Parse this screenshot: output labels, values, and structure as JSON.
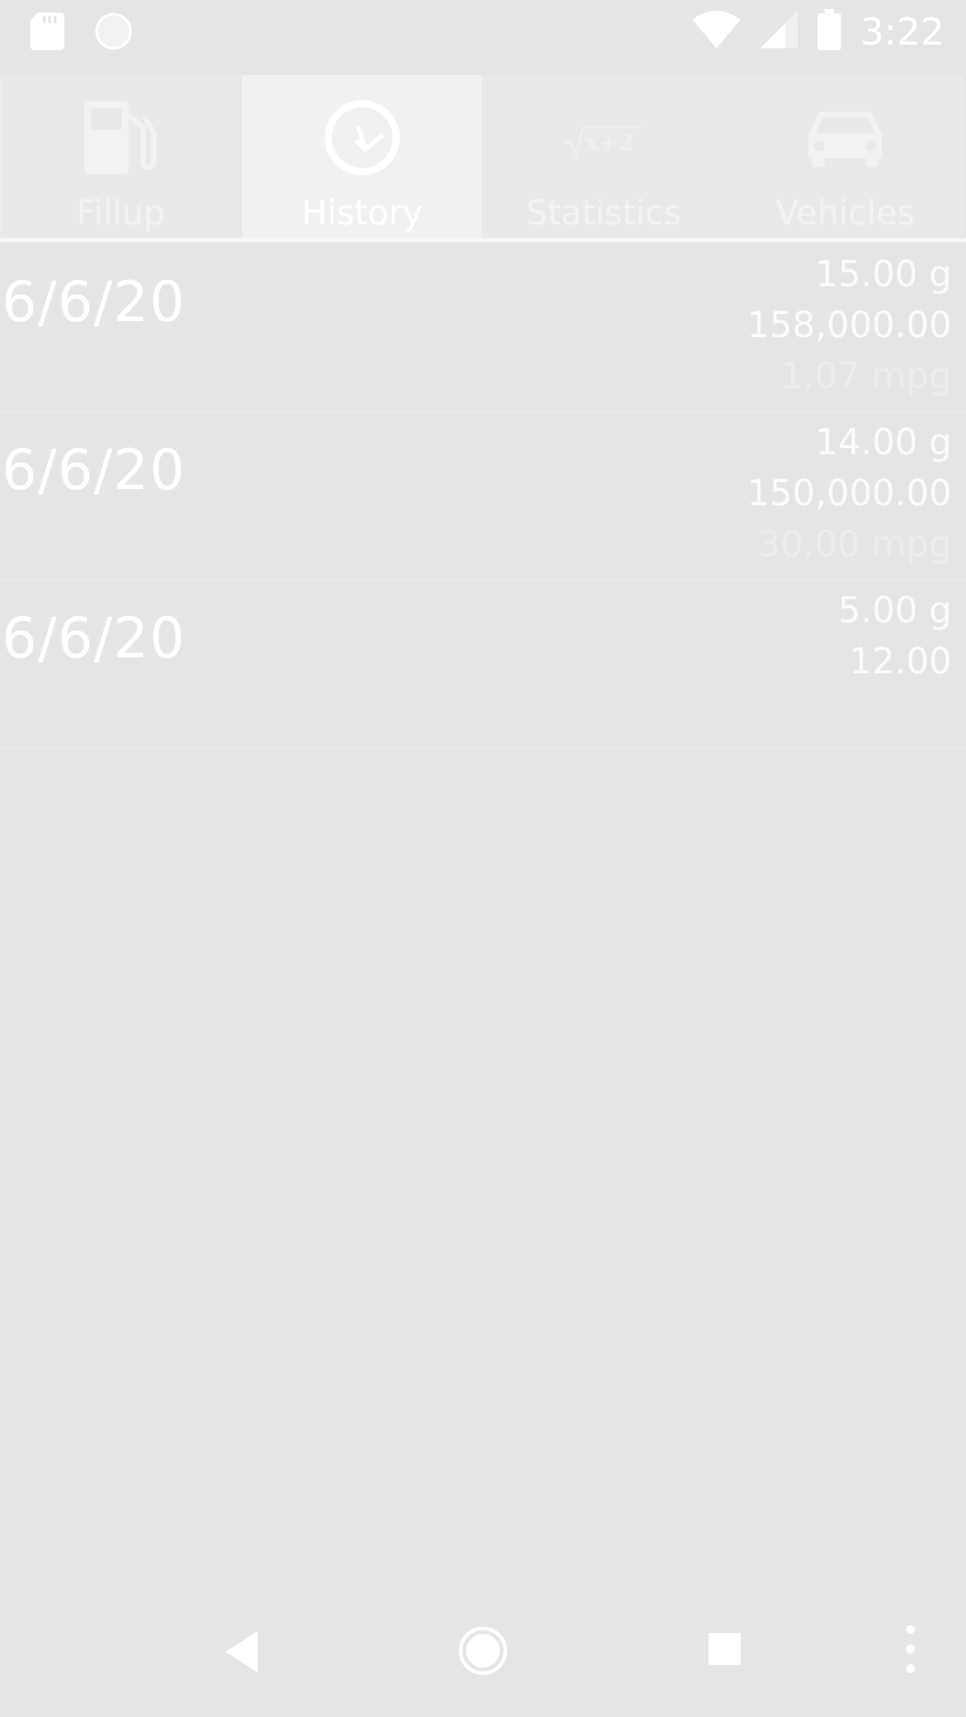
{
  "status_bar": {
    "time": "3:22",
    "icons": [
      "sd-card-icon",
      "sync-circle-icon",
      "wifi-icon",
      "signal-icon",
      "battery-icon"
    ]
  },
  "tabs": [
    {
      "label": "Fillup",
      "icon": "fuel-pump-icon",
      "active": false
    },
    {
      "label": "History",
      "icon": "clock-icon",
      "active": true
    },
    {
      "label": "Statistics",
      "icon": "sqrt-formula-icon",
      "active": false
    },
    {
      "label": "Vehicles",
      "icon": "car-icon",
      "active": false
    }
  ],
  "history": [
    {
      "date": "6/6/20",
      "gallons": "15.00 g",
      "odometer": "158,000.00",
      "mpg": "1.07 mpg"
    },
    {
      "date": "6/6/20",
      "gallons": "14.00 g",
      "odometer": "150,000.00",
      "mpg": "30.00 mpg"
    },
    {
      "date": "6/6/20",
      "gallons": "5.00 g",
      "odometer": "12.00",
      "mpg": ""
    }
  ],
  "nav_bar": {
    "icons": [
      "back-icon",
      "home-icon",
      "recents-icon",
      "overflow-menu-icon"
    ]
  },
  "colors": {
    "background": "#e5e5e6",
    "tab_background": "#e9e9ea",
    "tab_active_background": "#f1f1f2",
    "text": "#ffffff"
  }
}
